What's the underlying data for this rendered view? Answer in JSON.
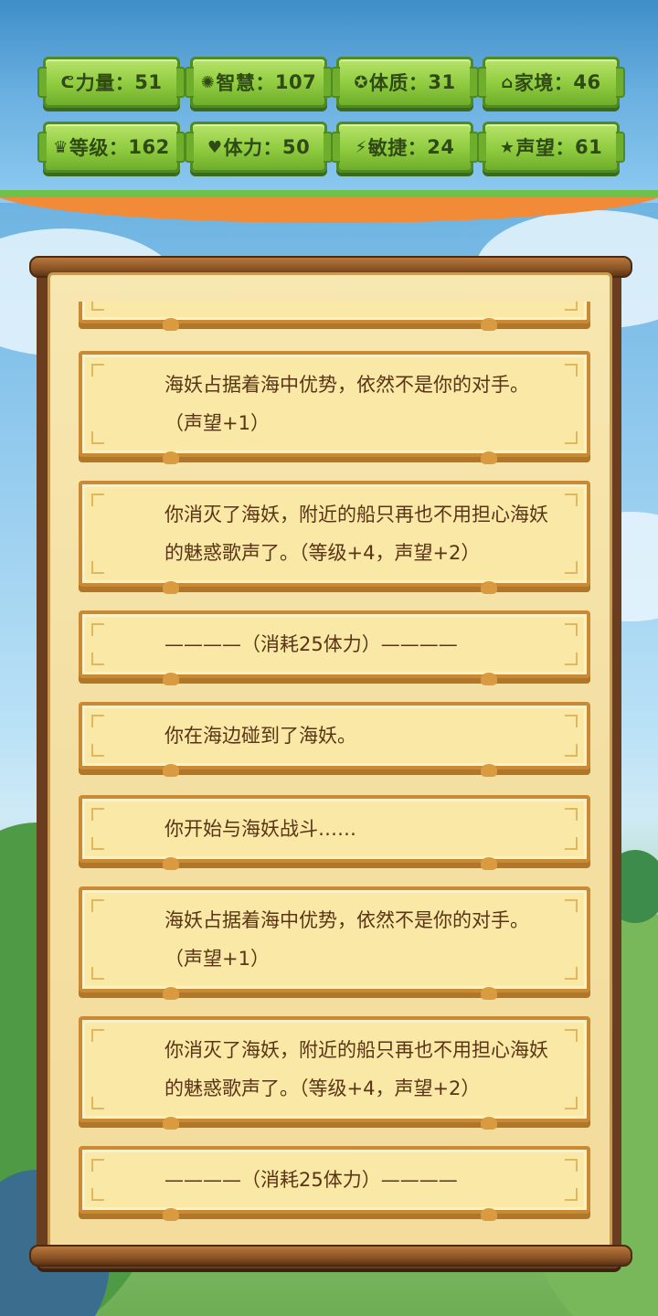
{
  "stats": [
    {
      "icon": "strength-icon",
      "glyph": "ᕦ",
      "label": "力量",
      "value": "51"
    },
    {
      "icon": "wisdom-icon",
      "glyph": "✺",
      "label": "智慧",
      "value": "107"
    },
    {
      "icon": "constitution-icon",
      "glyph": "✪",
      "label": "体质",
      "value": "31"
    },
    {
      "icon": "family-icon",
      "glyph": "⌂",
      "label": "家境",
      "value": "46"
    },
    {
      "icon": "level-icon",
      "glyph": "♛",
      "label": "等级",
      "value": "162"
    },
    {
      "icon": "stamina-icon",
      "glyph": "♥",
      "label": "体力",
      "value": "50"
    },
    {
      "icon": "agility-icon",
      "glyph": "⚡",
      "label": "敏捷",
      "value": "24"
    },
    {
      "icon": "reputation-icon",
      "glyph": "★",
      "label": "声望",
      "value": "61"
    }
  ],
  "log": [
    {
      "text": "海妖占据着海中优势，依然不是你的对手。（声望+1）"
    },
    {
      "text": "你消灭了海妖，附近的船只再也不用担心海妖的魅惑歌声了。（等级+4，声望+2）"
    },
    {
      "text": "————（消耗25体力）————"
    },
    {
      "text": "你在海边碰到了海妖。"
    },
    {
      "text": "你开始与海妖战斗……"
    },
    {
      "text": "海妖占据着海中优势，依然不是你的对手。（声望+1）"
    },
    {
      "text": "你消灭了海妖，附近的船只再也不用担心海妖的魅惑歌声了。（等级+4，声望+2）"
    },
    {
      "text": "————（消耗25体力）————"
    }
  ],
  "stat_separator": "："
}
